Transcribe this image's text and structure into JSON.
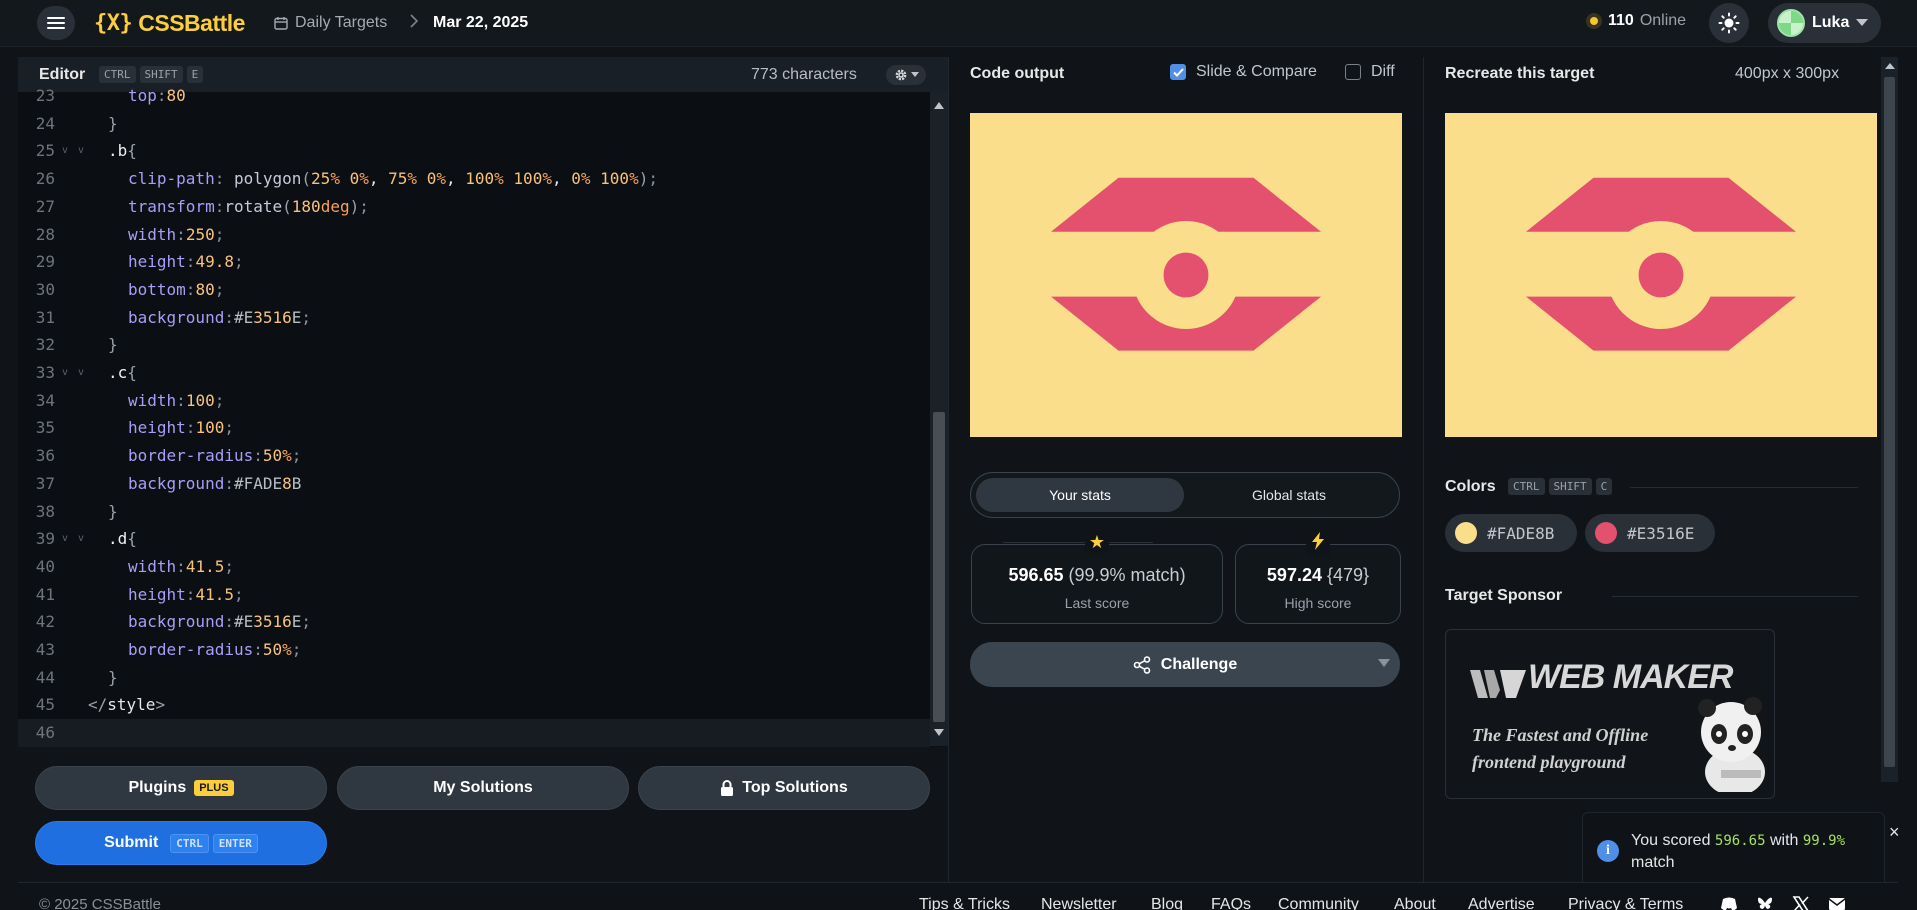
{
  "header": {
    "logo_text": "CSSBattle",
    "logo_mark": "{X}",
    "breadcrumb_daily": "Daily Targets",
    "breadcrumb_date": "Mar 22, 2025",
    "online_count": "110",
    "online_label": "Online",
    "user_name": "Luka"
  },
  "editor": {
    "title": "Editor",
    "shortcut": [
      "CTRL",
      "SHIFT",
      "E"
    ],
    "char_count": "773 characters",
    "lines": [
      {
        "n": "23",
        "code": "top:80"
      },
      {
        "n": "24",
        "code": "}"
      },
      {
        "n": "25",
        "code": ".b{"
      },
      {
        "n": "26",
        "code": "clip-path: polygon(25% 0%, 75% 0%, 100% 100%, 0% 100%);"
      },
      {
        "n": "27",
        "code": "transform:rotate(180deg);"
      },
      {
        "n": "28",
        "code": "width:250;"
      },
      {
        "n": "29",
        "code": "height:49.8;"
      },
      {
        "n": "30",
        "code": "bottom:80;"
      },
      {
        "n": "31",
        "code": "background:#E3516E;"
      },
      {
        "n": "32",
        "code": "}"
      },
      {
        "n": "33",
        "code": ".c{"
      },
      {
        "n": "34",
        "code": "width:100;"
      },
      {
        "n": "35",
        "code": "height:100;"
      },
      {
        "n": "36",
        "code": "border-radius:50%;"
      },
      {
        "n": "37",
        "code": "background:#FADE8B"
      },
      {
        "n": "38",
        "code": "}"
      },
      {
        "n": "39",
        "code": ".d{"
      },
      {
        "n": "40",
        "code": "width:41.5;"
      },
      {
        "n": "41",
        "code": "height:41.5;"
      },
      {
        "n": "42",
        "code": "background:#E3516E;"
      },
      {
        "n": "43",
        "code": "border-radius:50%;"
      },
      {
        "n": "44",
        "code": "}"
      },
      {
        "n": "45",
        "code": "</style>"
      },
      {
        "n": "46",
        "code": ""
      }
    ]
  },
  "actions": {
    "plugins": "Plugins",
    "plus_badge": "PLUS",
    "my_solutions": "My Solutions",
    "top_solutions": "Top Solutions",
    "submit": "Submit",
    "submit_keys": [
      "CTRL",
      "ENTER"
    ]
  },
  "output": {
    "title": "Code output",
    "slide_compare": "Slide & Compare",
    "slide_compare_checked": true,
    "diff": "Diff",
    "diff_checked": false,
    "tab_your_stats": "Your stats",
    "tab_global_stats": "Global stats",
    "last_score": "596.65",
    "last_match": "(99.9% match)",
    "last_label": "Last score",
    "high_score": "597.24",
    "high_chars": "{479}",
    "high_label": "High score",
    "challenge": "Challenge"
  },
  "target": {
    "title": "Recreate this target",
    "size": "400px x 300px",
    "colors_title": "Colors",
    "colors_keys": [
      "CTRL",
      "SHIFT",
      "C"
    ],
    "colors": [
      "#FADE8B",
      "#E3516E"
    ],
    "sponsor_title": "Target Sponsor",
    "sponsor_logo": "WEB MAKER",
    "sponsor_tagline": "The Fastest and Offline frontend playground"
  },
  "toast": {
    "prefix": "You scored",
    "score": "596.65",
    "mid": "with",
    "match": "99.9%",
    "suffix": "match"
  },
  "footer": {
    "copyright": "© 2025 CSSBattle",
    "links": [
      "Tips & Tricks",
      "Newsletter",
      "Blog",
      "FAQs",
      "Community",
      "About",
      "Advertise",
      "Privacy & Terms"
    ]
  },
  "theme": {
    "accent": "#FDCE3B",
    "target_bg": "#FADE8B",
    "target_fg": "#E3516E",
    "primary_button": "#1F6FE0"
  }
}
